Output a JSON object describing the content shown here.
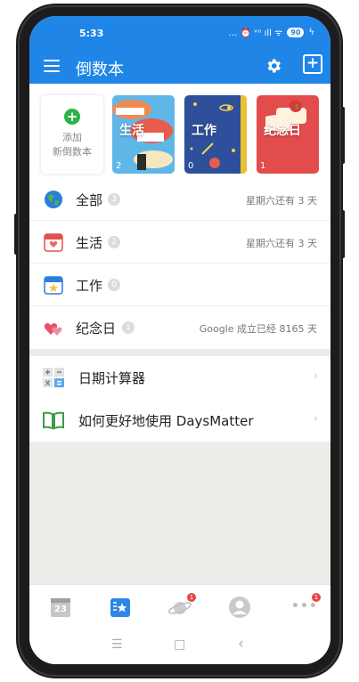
{
  "status_bar": {
    "time": "5:33",
    "indicators": "... ⏰ ᵛᵒ ıll ᯤ",
    "battery": "90"
  },
  "app_bar": {
    "title": "倒数本",
    "settings_icon": "gear-icon",
    "add_icon": "plus-square-icon"
  },
  "books": {
    "add": {
      "line1": "添加",
      "line2": "新倒数本"
    },
    "items": [
      {
        "label": "生活",
        "count": "2",
        "color": "#5fb7e8"
      },
      {
        "label": "工作",
        "count": "0",
        "color": "#2d4f9c"
      },
      {
        "label": "纪念日",
        "count": "1",
        "color": "#e34c4c"
      }
    ]
  },
  "categories": [
    {
      "name": "全部",
      "count": "3",
      "status": "星期六还有 3 天",
      "icon": "globe-icon"
    },
    {
      "name": "生活",
      "count": "2",
      "status": "星期六还有 3 天",
      "icon": "calendar-heart-icon"
    },
    {
      "name": "工作",
      "count": "0",
      "status": "",
      "icon": "calendar-star-icon"
    },
    {
      "name": "纪念日",
      "count": "1",
      "status": "Google 成立已经 8165 天",
      "icon": "hearts-icon"
    }
  ],
  "tools": [
    {
      "name": "日期计算器",
      "icon": "calculator-icon"
    },
    {
      "name": "如何更好地使用 DaysMatter",
      "icon": "book-icon"
    }
  ],
  "bottom_nav": {
    "calendar_day": "23",
    "planet_badge": "1",
    "more_badge": "1"
  },
  "system_nav": {
    "menu": "☰",
    "home": "□",
    "back": "‹"
  }
}
